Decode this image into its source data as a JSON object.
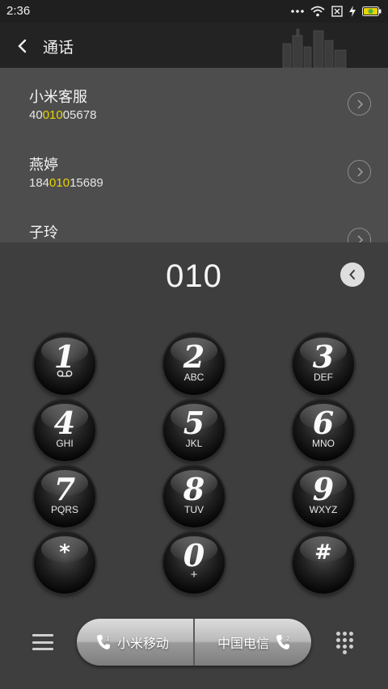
{
  "status_bar": {
    "time": "2:36",
    "icons": [
      "more-dots-icon",
      "wifi-icon",
      "no-sim-icon",
      "charging-icon",
      "battery-icon"
    ]
  },
  "header": {
    "title": "通话"
  },
  "contacts": [
    {
      "name": "小米客服",
      "number_pre": "40",
      "number_match": "010",
      "number_post": "05678"
    },
    {
      "name": "燕婷",
      "number_pre": "184",
      "number_match": "010",
      "number_post": "15689"
    },
    {
      "name": "子玲",
      "number_pre": "",
      "number_match": "",
      "number_post": ""
    }
  ],
  "dialer": {
    "input": "010",
    "keys": [
      {
        "digit": "1",
        "letters": "",
        "icon": "voicemail-icon"
      },
      {
        "digit": "2",
        "letters": "ABC"
      },
      {
        "digit": "3",
        "letters": "DEF"
      },
      {
        "digit": "4",
        "letters": "GHI"
      },
      {
        "digit": "5",
        "letters": "JKL"
      },
      {
        "digit": "6",
        "letters": "MNO"
      },
      {
        "digit": "7",
        "letters": "PQRS"
      },
      {
        "digit": "8",
        "letters": "TUV"
      },
      {
        "digit": "9",
        "letters": "WXYZ"
      },
      {
        "digit": "*",
        "letters": ""
      },
      {
        "digit": "0",
        "letters": "+"
      },
      {
        "digit": "#",
        "letters": ""
      }
    ]
  },
  "bottom_bar": {
    "sim1_label": "小米移动",
    "sim2_label": "中国电信",
    "sim2_badge": "2"
  },
  "colors": {
    "highlight": "#e8d400",
    "header_bg": "#232323",
    "list_bg": "#4d4d4d",
    "dialer_bg": "#3e3e3e"
  }
}
